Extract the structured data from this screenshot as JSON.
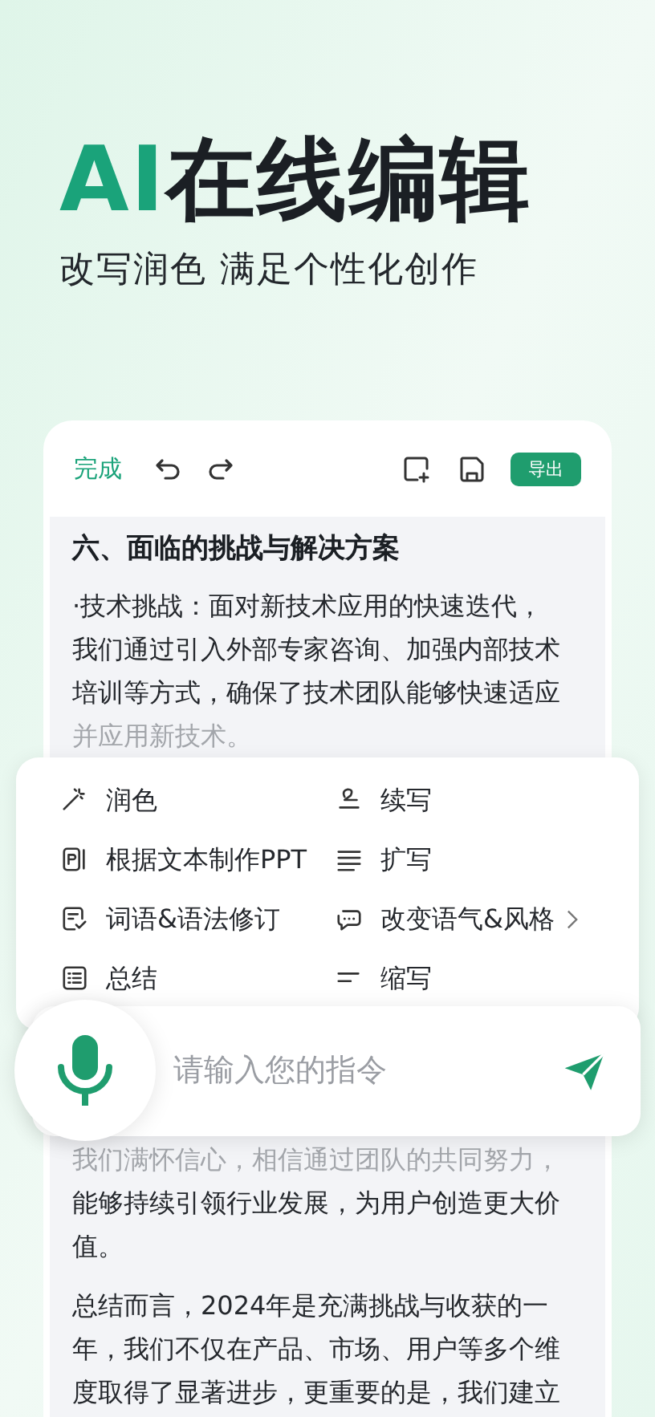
{
  "hero": {
    "title_accent": "AI",
    "title_rest": "在线编辑",
    "subtitle": "改写润色 满足个性化创作"
  },
  "toolbar": {
    "done": "完成",
    "export": "导出"
  },
  "document": {
    "heading": "六、面临的挑战与解决方案",
    "top_lines": [
      {
        "text": "·技术挑战：面对新技术应用的快速迭代，",
        "faded": false
      },
      {
        "text": "我们通过引入外部专家咨询、加强内部技术",
        "faded": false
      },
      {
        "text": "培训等方式，确保了技术团队能够快速适应",
        "faded": false
      },
      {
        "text": "并应用新技术。",
        "faded": true
      }
    ],
    "bottom_paragraphs": [
      {
        "lines": [
          {
            "text": "我们满怀信心，相信通过团队的共同努力，",
            "faded": true
          },
          {
            "text": "能够持续引领行业发展，为用户创造更大价",
            "faded": false
          },
          {
            "text": "值。",
            "faded": false
          }
        ]
      },
      {
        "lines": [
          {
            "text": "总结而言，2024年是充满挑战与收获的一",
            "faded": false
          },
          {
            "text": "年，我们不仅在产品、市场、用户等多个维",
            "faded": false
          },
          {
            "text": "度取得了显著进步，更重要的是，我们建立",
            "faded": false
          }
        ]
      }
    ]
  },
  "ai_menu": [
    {
      "kind": "wand",
      "label": "润色",
      "has_submenu": false
    },
    {
      "kind": "continue",
      "label": "续写",
      "has_submenu": false
    },
    {
      "kind": "ppt",
      "label": "根据文本制作PPT",
      "has_submenu": false
    },
    {
      "kind": "expand",
      "label": "扩写",
      "has_submenu": false
    },
    {
      "kind": "revise",
      "label": "词语&语法修订",
      "has_submenu": false
    },
    {
      "kind": "tone",
      "label": "改变语气&风格",
      "has_submenu": true
    },
    {
      "kind": "summary",
      "label": "总结",
      "has_submenu": false
    },
    {
      "kind": "shorten",
      "label": "缩写",
      "has_submenu": false
    }
  ],
  "prompt": {
    "placeholder": "请输入您的指令"
  }
}
